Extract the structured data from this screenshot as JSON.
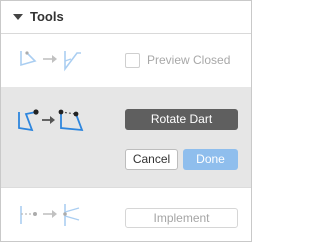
{
  "panel": {
    "title": "Tools"
  },
  "tools": [
    {
      "icon": "close-dart-icon",
      "checkbox_label": "Preview Closed",
      "checked": false
    },
    {
      "icon": "rotate-dart-icon",
      "action_label": "Rotate Dart",
      "cancel_label": "Cancel",
      "done_label": "Done"
    },
    {
      "icon": "implement-dart-icon",
      "action_label": "Implement"
    }
  ],
  "colors": {
    "accent_blue": "#2e86de",
    "done_disabled": "#8fbeed",
    "active_row_bg": "#e6e6e6",
    "primary_button": "#5f5f5f"
  }
}
